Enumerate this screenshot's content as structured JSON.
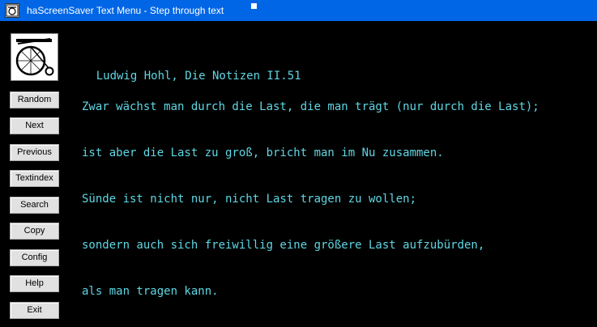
{
  "window": {
    "title": "haScreenSaver Text Menu - Step through text",
    "icon": "app-icon",
    "accent": "#0066e6"
  },
  "logo": {
    "icon": "penny-farthing-bicycle-icon"
  },
  "buttons": [
    {
      "name": "random-button",
      "label": "Random"
    },
    {
      "name": "next-button",
      "label": "Next"
    },
    {
      "name": "previous-button",
      "label": "Previous"
    },
    {
      "name": "textindex-button",
      "label": "Textindex"
    },
    {
      "name": "search-button",
      "label": "Search"
    },
    {
      "name": "copy-button",
      "label": "Copy"
    },
    {
      "name": "config-button",
      "label": "Config"
    },
    {
      "name": "help-button",
      "label": "Help"
    },
    {
      "name": "exit-button",
      "label": "Exit"
    }
  ],
  "text": {
    "heading": "Ludwig Hohl, Die Notizen II.51",
    "lines": [
      "Zwar wächst man durch die Last, die man trägt (nur durch die Last);",
      "ist aber die Last zu groß, bricht man im Nu zusammen.",
      "Sünde ist nicht nur, nicht Last tragen zu wollen;",
      "sondern auch sich freiwillig eine größere Last aufzubürden,",
      "als man tragen kann."
    ],
    "color": "#5fd7e4"
  }
}
